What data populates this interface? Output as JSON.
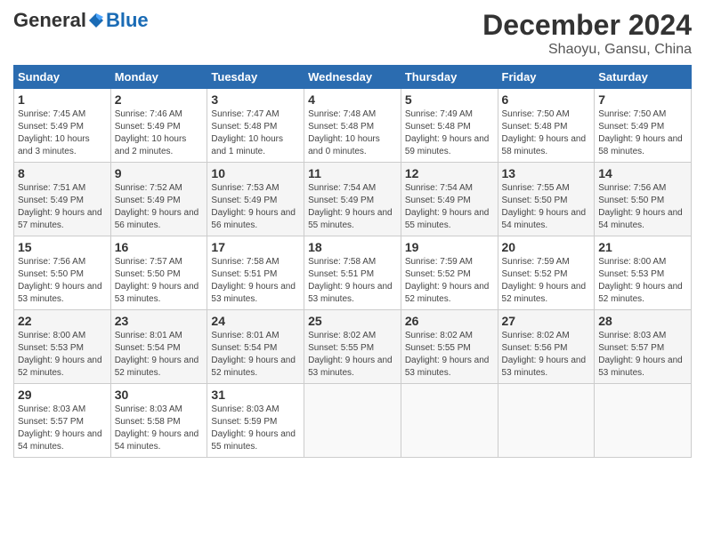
{
  "header": {
    "logo_general": "General",
    "logo_blue": "Blue",
    "main_title": "December 2024",
    "subtitle": "Shaoyu, Gansu, China"
  },
  "days_of_week": [
    "Sunday",
    "Monday",
    "Tuesday",
    "Wednesday",
    "Thursday",
    "Friday",
    "Saturday"
  ],
  "weeks": [
    [
      {
        "day": "1",
        "sunrise": "7:45 AM",
        "sunset": "5:49 PM",
        "daylight": "10 hours and 3 minutes."
      },
      {
        "day": "2",
        "sunrise": "7:46 AM",
        "sunset": "5:49 PM",
        "daylight": "10 hours and 2 minutes."
      },
      {
        "day": "3",
        "sunrise": "7:47 AM",
        "sunset": "5:48 PM",
        "daylight": "10 hours and 1 minute."
      },
      {
        "day": "4",
        "sunrise": "7:48 AM",
        "sunset": "5:48 PM",
        "daylight": "10 hours and 0 minutes."
      },
      {
        "day": "5",
        "sunrise": "7:49 AM",
        "sunset": "5:48 PM",
        "daylight": "9 hours and 59 minutes."
      },
      {
        "day": "6",
        "sunrise": "7:50 AM",
        "sunset": "5:48 PM",
        "daylight": "9 hours and 58 minutes."
      },
      {
        "day": "7",
        "sunrise": "7:50 AM",
        "sunset": "5:49 PM",
        "daylight": "9 hours and 58 minutes."
      }
    ],
    [
      {
        "day": "8",
        "sunrise": "7:51 AM",
        "sunset": "5:49 PM",
        "daylight": "9 hours and 57 minutes."
      },
      {
        "day": "9",
        "sunrise": "7:52 AM",
        "sunset": "5:49 PM",
        "daylight": "9 hours and 56 minutes."
      },
      {
        "day": "10",
        "sunrise": "7:53 AM",
        "sunset": "5:49 PM",
        "daylight": "9 hours and 56 minutes."
      },
      {
        "day": "11",
        "sunrise": "7:54 AM",
        "sunset": "5:49 PM",
        "daylight": "9 hours and 55 minutes."
      },
      {
        "day": "12",
        "sunrise": "7:54 AM",
        "sunset": "5:49 PM",
        "daylight": "9 hours and 55 minutes."
      },
      {
        "day": "13",
        "sunrise": "7:55 AM",
        "sunset": "5:50 PM",
        "daylight": "9 hours and 54 minutes."
      },
      {
        "day": "14",
        "sunrise": "7:56 AM",
        "sunset": "5:50 PM",
        "daylight": "9 hours and 54 minutes."
      }
    ],
    [
      {
        "day": "15",
        "sunrise": "7:56 AM",
        "sunset": "5:50 PM",
        "daylight": "9 hours and 53 minutes."
      },
      {
        "day": "16",
        "sunrise": "7:57 AM",
        "sunset": "5:50 PM",
        "daylight": "9 hours and 53 minutes."
      },
      {
        "day": "17",
        "sunrise": "7:58 AM",
        "sunset": "5:51 PM",
        "daylight": "9 hours and 53 minutes."
      },
      {
        "day": "18",
        "sunrise": "7:58 AM",
        "sunset": "5:51 PM",
        "daylight": "9 hours and 53 minutes."
      },
      {
        "day": "19",
        "sunrise": "7:59 AM",
        "sunset": "5:52 PM",
        "daylight": "9 hours and 52 minutes."
      },
      {
        "day": "20",
        "sunrise": "7:59 AM",
        "sunset": "5:52 PM",
        "daylight": "9 hours and 52 minutes."
      },
      {
        "day": "21",
        "sunrise": "8:00 AM",
        "sunset": "5:53 PM",
        "daylight": "9 hours and 52 minutes."
      }
    ],
    [
      {
        "day": "22",
        "sunrise": "8:00 AM",
        "sunset": "5:53 PM",
        "daylight": "9 hours and 52 minutes."
      },
      {
        "day": "23",
        "sunrise": "8:01 AM",
        "sunset": "5:54 PM",
        "daylight": "9 hours and 52 minutes."
      },
      {
        "day": "24",
        "sunrise": "8:01 AM",
        "sunset": "5:54 PM",
        "daylight": "9 hours and 52 minutes."
      },
      {
        "day": "25",
        "sunrise": "8:02 AM",
        "sunset": "5:55 PM",
        "daylight": "9 hours and 53 minutes."
      },
      {
        "day": "26",
        "sunrise": "8:02 AM",
        "sunset": "5:55 PM",
        "daylight": "9 hours and 53 minutes."
      },
      {
        "day": "27",
        "sunrise": "8:02 AM",
        "sunset": "5:56 PM",
        "daylight": "9 hours and 53 minutes."
      },
      {
        "day": "28",
        "sunrise": "8:03 AM",
        "sunset": "5:57 PM",
        "daylight": "9 hours and 53 minutes."
      }
    ],
    [
      {
        "day": "29",
        "sunrise": "8:03 AM",
        "sunset": "5:57 PM",
        "daylight": "9 hours and 54 minutes."
      },
      {
        "day": "30",
        "sunrise": "8:03 AM",
        "sunset": "5:58 PM",
        "daylight": "9 hours and 54 minutes."
      },
      {
        "day": "31",
        "sunrise": "8:03 AM",
        "sunset": "5:59 PM",
        "daylight": "9 hours and 55 minutes."
      },
      null,
      null,
      null,
      null
    ]
  ]
}
